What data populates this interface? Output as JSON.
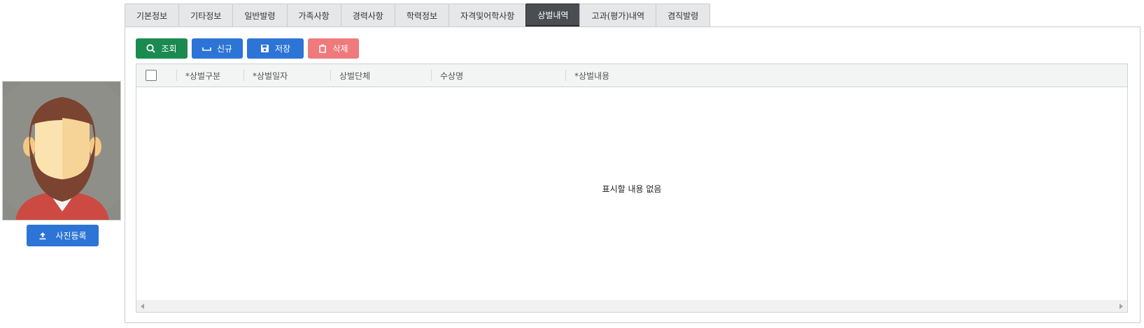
{
  "profile": {
    "upload_label": "사진등록"
  },
  "tabs": [
    {
      "label": "기본정보",
      "active": false
    },
    {
      "label": "기타정보",
      "active": false
    },
    {
      "label": "일반발령",
      "active": false
    },
    {
      "label": "가족사항",
      "active": false
    },
    {
      "label": "경력사항",
      "active": false
    },
    {
      "label": "학력정보",
      "active": false
    },
    {
      "label": "자격및어학사항",
      "active": false
    },
    {
      "label": "상벌내역",
      "active": true
    },
    {
      "label": "고과(평가)내역",
      "active": false
    },
    {
      "label": "겸직발령",
      "active": false
    }
  ],
  "toolbar": {
    "search_label": "조회",
    "new_label": "신규",
    "save_label": "저장",
    "delete_label": "삭제"
  },
  "grid": {
    "columns": [
      "*상벌구분",
      "*상벌일자",
      "상벌단체",
      "수상명",
      "*상벌내용"
    ],
    "empty_message": "표시할 내용 없음"
  },
  "colors": {
    "search_button": "#1a8a51",
    "primary_button": "#2c74d6",
    "delete_button": "#ee7a7c",
    "active_tab": "#4a4d52"
  }
}
